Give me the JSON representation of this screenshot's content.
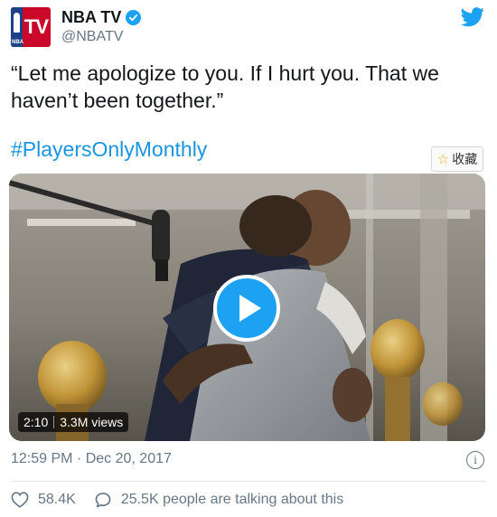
{
  "author": {
    "display_name": "NBA TV",
    "handle": "@NBATV",
    "avatar_text": "TV",
    "avatar_small_text": "NBA",
    "verified": true
  },
  "tweet": {
    "text": "“Let me apologize to you. If I hurt you. That we haven’t been together.”",
    "hashtag": "#PlayersOnlyMonthly"
  },
  "collect_button": {
    "icon": "star-icon",
    "label": "收藏"
  },
  "media": {
    "duration": "2:10",
    "views": "3.3M views",
    "play_icon": "play-icon"
  },
  "footer": {
    "timestamp": "12:59 PM · Dec 20, 2017",
    "info_icon": "info-icon"
  },
  "actions": {
    "likes": "58.4K",
    "conversation": "25.5K people are talking about this"
  },
  "colors": {
    "accent": "#1da1f2",
    "link": "#1b95e0",
    "muted": "#657786",
    "nba_red": "#c9082a",
    "nba_blue": "#1d428a"
  }
}
